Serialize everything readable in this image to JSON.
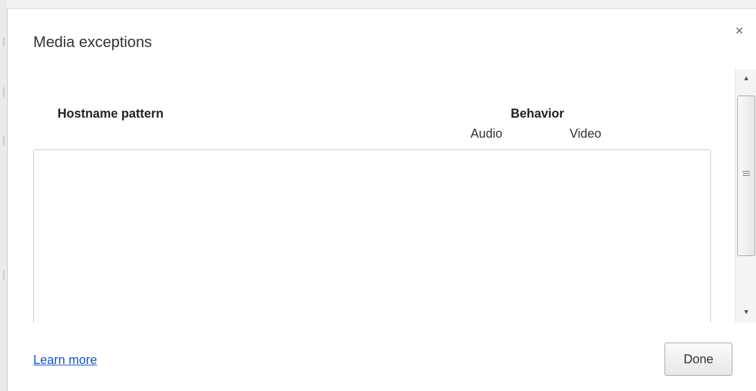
{
  "dialog": {
    "title": "Media exceptions",
    "close_glyph": "×",
    "close_icon": "close-icon"
  },
  "table": {
    "hostname_header": "Hostname pattern",
    "behavior_header": "Behavior",
    "behavior_subheaders": [
      "Audio",
      "Video"
    ],
    "rows": []
  },
  "scrollbar": {
    "up_glyph": "▲",
    "down_glyph": "▼",
    "up_icon": "scroll-up-arrow-icon",
    "down_icon": "scroll-down-arrow-icon"
  },
  "footer": {
    "learn_more_label": "Learn more",
    "done_label": "Done"
  },
  "colors": {
    "link": "#1155cc",
    "border": "#c8c8c8",
    "background": "#ffffff"
  }
}
